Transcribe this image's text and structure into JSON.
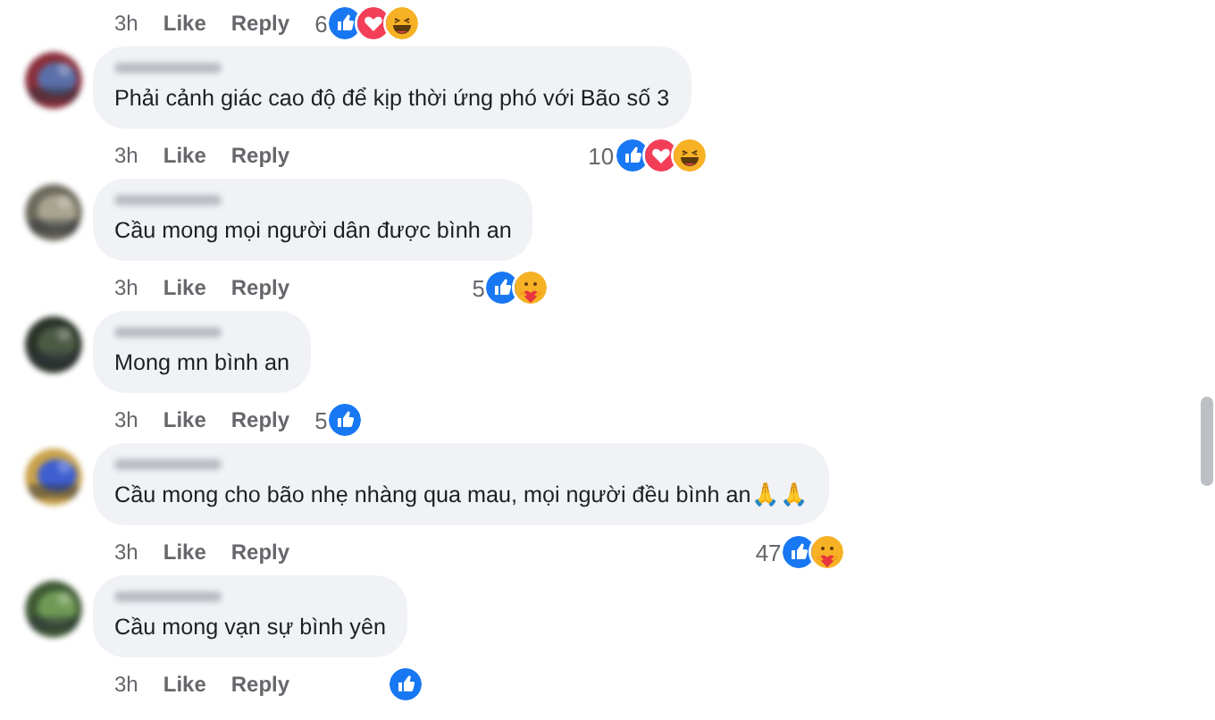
{
  "top_actions": {
    "time": "3h",
    "actions": [
      "Like",
      "Reply"
    ],
    "reaction_count": "6",
    "reactions": [
      {
        "kind": "like"
      },
      {
        "kind": "love"
      },
      {
        "kind": "haha"
      }
    ]
  },
  "comments": [
    {
      "text": "Phải cảnh giác cao độ để kịp thời ứng phó với Bão số 3",
      "time": "3h",
      "actions": [
        "Like",
        "Reply"
      ],
      "reaction_count": "10",
      "reactions": [
        {
          "kind": "like"
        },
        {
          "kind": "love"
        },
        {
          "kind": "haha"
        }
      ]
    },
    {
      "text": "Cầu mong mọi người dân được bình an",
      "time": "3h",
      "actions": [
        "Like",
        "Reply"
      ],
      "reaction_count": "5",
      "reactions": [
        {
          "kind": "like"
        },
        {
          "kind": "care"
        }
      ]
    },
    {
      "text": "Mong mn bình an",
      "time": "3h",
      "actions": [
        "Like",
        "Reply"
      ],
      "reaction_count": "5",
      "reactions": [
        {
          "kind": "like"
        }
      ]
    },
    {
      "text": "Cầu mong cho bão nhẹ nhàng qua mau, mọi người đều bình an🙏🙏",
      "time": "3h",
      "actions": [
        "Like",
        "Reply"
      ],
      "reaction_count": "47",
      "reactions": [
        {
          "kind": "like"
        },
        {
          "kind": "care"
        }
      ]
    },
    {
      "text": "Cầu mong vạn sự bình yên",
      "time": "3h",
      "actions": [
        "Like",
        "Reply"
      ],
      "reactions": [
        {
          "kind": "like"
        }
      ]
    }
  ]
}
